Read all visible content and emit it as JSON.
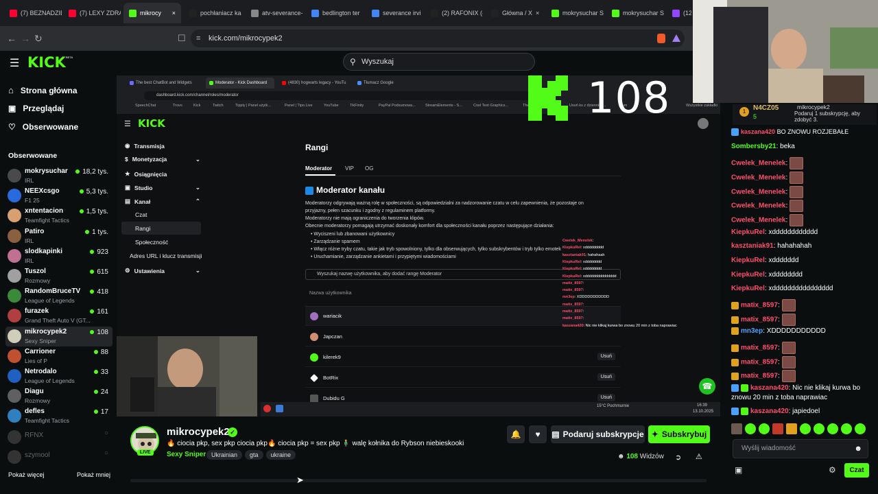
{
  "browser": {
    "tabs": [
      {
        "label": "(7) BEZNADZIE"
      },
      {
        "label": "(7) LEXY ZDRA"
      },
      {
        "label": "mikrocy"
      },
      {
        "label": "pochłaniacz ka"
      },
      {
        "label": "atv-severance-"
      },
      {
        "label": "bedlington ter"
      },
      {
        "label": "severance irvi"
      },
      {
        "label": "(2) RAFONIX (@"
      },
      {
        "label": "Główna / X"
      },
      {
        "label": "mokrysuchar S"
      },
      {
        "label": "mokrysuchar S"
      },
      {
        "label": "(12) p"
      }
    ],
    "url": "kick.com/mikrocypek2"
  },
  "kick": {
    "logo": "KICK",
    "logo_beta": "BETA",
    "search_placeholder": "Wyszukaj"
  },
  "sidebar": {
    "nav": [
      {
        "label": "Strona główna"
      },
      {
        "label": "Przeglądaj"
      },
      {
        "label": "Obserwowane"
      }
    ],
    "section_title": "Obserwowane",
    "channels": [
      {
        "name": "mokrysuchar",
        "category": "IRL",
        "viewers": "18,2 tys."
      },
      {
        "name": "NEEXcsgo",
        "category": "F1 25",
        "viewers": "5,3 tys."
      },
      {
        "name": "xntentacion",
        "category": "Teamfight Tactics",
        "viewers": "1,5 tys."
      },
      {
        "name": "Patiro",
        "category": "IRL",
        "viewers": "1 tys."
      },
      {
        "name": "slodkapinki",
        "category": "IRL",
        "viewers": "923"
      },
      {
        "name": "Tuszol",
        "category": "Rozmowy",
        "viewers": "615"
      },
      {
        "name": "RandomBruceTV",
        "category": "League of Legends",
        "viewers": "418"
      },
      {
        "name": "furazek",
        "category": "Grand Theft Auto V (GT...",
        "viewers": "161"
      },
      {
        "name": "mikrocypek2",
        "category": "Sexy Sniper",
        "viewers": "108"
      },
      {
        "name": "Carrioner",
        "category": "Lies of P",
        "viewers": "88"
      },
      {
        "name": "Netrodalo",
        "category": "League of Legends",
        "viewers": "33"
      },
      {
        "name": "Diagu",
        "category": "Rozmowy",
        "viewers": "24"
      },
      {
        "name": "defles",
        "category": "Teamfight Tactics",
        "viewers": "17"
      }
    ],
    "offline": [
      {
        "name": "RFNX"
      },
      {
        "name": "szymool"
      }
    ],
    "show_more": "Pokaż więcej",
    "show_less": "Pokaż mniej"
  },
  "inner": {
    "tabs": [
      "The best ChatBot and Widgets",
      "Moderator - Kick Dashboard",
      "(4830) hogwarts legacy - YouTu",
      "Tłumacz Google"
    ],
    "url": "dashboard.kick.com/channel/roles/moderator",
    "bookmarks": [
      "SpeechChat",
      "Trovo",
      "Kick",
      "Twitch",
      "Tipply | Panel użytk...",
      "Panel | Tipo.Live",
      "YouTube",
      "TikFinity",
      "PayPal Podsumowa...",
      "StreamElements - S...",
      "Cool Text Graphics...",
      "The",
      "Usuń ks z dziennika...",
      "Tłum",
      "Wszystkie zakładki"
    ],
    "dash_nav": [
      "Transmisja",
      "Monetyzacja",
      "Osiągnięcia",
      "Studio",
      "Kanał"
    ],
    "dash_sub": [
      "Czat",
      "Rangi",
      "Społeczność"
    ],
    "dash_url_item": "Adres URL i klucz transmisji",
    "dash_settings": "Ustawienia",
    "page_title": "Rangi",
    "role_tabs": [
      "Moderator",
      "VIP",
      "OG"
    ],
    "section_title": "Moderator kanału",
    "desc1": "Moderatorzy odgrywają ważną rolę w społeczności, są odpowiedzialni za nadzorowanie czatu w celu zapewnienia, że pozostaje on",
    "desc2": "przyjazny, pełen szacunku i zgodny z regulaminem platformy.",
    "desc3": "Moderatorzy nie mają ograniczenia do tworzenia klipów.",
    "desc4": "Obecnie moderatorzy pomagają utrzymać doskonały komfort dla społeczności kanału poprzez następujące działania:",
    "bullets": [
      "Wyciszeni lub zbanowani użytkownicy",
      "Zarządzanie spamem",
      "Włącz różne tryby czatu, takie jak tryb spowolniony, tylko dla obserwujących, tylko subskrybentów i tryb tylko emotek",
      "Uruchamianie, zarządzanie ankietami i przypiętymi wiadomościami"
    ],
    "search_placeholder": "Wyszukaj nazwę użytkownika, aby dodać rangę Moderator",
    "col_header": "Nazwa użytkownika",
    "users": [
      "wariacik",
      "Japczan",
      "kilerek9",
      "BotRix",
      "Dubidu G"
    ],
    "remove_label": "Usuń",
    "weather": "15°C Pochmurnie",
    "time": "16:39",
    "date": "13.10.2025"
  },
  "overlay_chat": [
    {
      "user": "Cwelek_Menelek",
      "text": ":"
    },
    {
      "user": "KiepkuRel",
      "text": ": xddddddddd"
    },
    {
      "user": "kasztaniak91",
      "text": ": hahahaah"
    },
    {
      "user": "KiepkuRel",
      "text": ": xdddddddd"
    },
    {
      "user": "KiepkuRel",
      "text": ": xdddddddd"
    },
    {
      "user": "KiepkuRel",
      "text": ": xddddddddddddddd"
    },
    {
      "user": "matix_8597",
      "text": ":"
    },
    {
      "user": "matix_8597",
      "text": ":"
    },
    {
      "user": "mn3ep",
      "text": ": XDDDDDDDDDDD"
    },
    {
      "user": "matix_8597",
      "text": ":"
    },
    {
      "user": "matix_8597",
      "text": ":"
    },
    {
      "user": "matix_8597",
      "text": ":"
    },
    {
      "user": "kaszana420",
      "text": ": Nic nie klikaj kurwa bo znowu 20 min z toba naprawiac"
    }
  ],
  "viewer_overlay": {
    "count": "108"
  },
  "stream_info": {
    "channel": "mikrocypek2",
    "live_label": "LIVE",
    "title": "🔥 ciocia pkp, sex pkp ciocia pkp🔥 ciocia pkp = sex pkp 🧍‍♂️ walę kołnika do Rybson niebieskooki",
    "category": "Sexy Sniper",
    "tags": [
      "Ukrainian",
      "gta",
      "ukraine"
    ],
    "gift_label": "Podaruj subskrypcje",
    "subscribe_label": "Subskrybuj",
    "viewers": "108",
    "viewers_label": "Widzów"
  },
  "chat": {
    "goal_name": "N4CZ05",
    "goal_count": "5",
    "goal_user": "mikrocypek2",
    "goal_text": "Podaruj 1 subskrypcję, aby zdobyć 3.",
    "top_msg": {
      "user": "kaszana420",
      "text": "BO ZNOWU ROZJEBAŁE"
    },
    "messages": [
      {
        "user": "Sombersby21",
        "text": ": beka",
        "color": "#53fc18",
        "emote": false,
        "badge": false
      },
      {
        "user": "Cwelek_Menelek",
        "text": ":",
        "color": "#ff4d6d",
        "emote": true,
        "badge": false
      },
      {
        "user": "Cwelek_Menelek",
        "text": ":",
        "color": "#ff4d6d",
        "emote": true,
        "badge": false
      },
      {
        "user": "Cwelek_Menelek",
        "text": ":",
        "color": "#ff4d6d",
        "emote": true,
        "badge": false
      },
      {
        "user": "Cwelek_Menelek",
        "text": ":",
        "color": "#ff4d6d",
        "emote": true,
        "badge": false
      },
      {
        "user": "Cwelek_Menelek",
        "text": ":",
        "color": "#ff4d6d",
        "emote": true,
        "badge": false
      },
      {
        "user": "KiepkuRel",
        "text": ": xdddddddddddd",
        "color": "#ff4d6d",
        "emote": false,
        "badge": false
      },
      {
        "user": "kasztaniak91",
        "text": ": hahahahah",
        "color": "#ff4d6d",
        "emote": false,
        "badge": false
      },
      {
        "user": "KiepkuRel",
        "text": ": xddddddd",
        "color": "#ff4d6d",
        "emote": false,
        "badge": false
      },
      {
        "user": "KiepkuRel",
        "text": ": xdddddddd",
        "color": "#ff4d6d",
        "emote": false,
        "badge": false
      },
      {
        "user": "KiepkuRel",
        "text": ": xdddddddddddddddd",
        "color": "#ff4d6d",
        "emote": false,
        "badge": false
      },
      {
        "user": "matix_8597",
        "text": ":",
        "color": "#ff4d6d",
        "emote": true,
        "badge": true
      },
      {
        "user": "matix_8597",
        "text": ":",
        "color": "#ff4d6d",
        "emote": true,
        "badge": true
      },
      {
        "user": "mn3ep",
        "text": ": XDDDDDDDDDDD",
        "color": "#53a0ff",
        "emote": false,
        "badge": true
      },
      {
        "user": "matix_8597",
        "text": ":",
        "color": "#ff4d6d",
        "emote": true,
        "badge": true
      },
      {
        "user": "matix_8597",
        "text": ":",
        "color": "#ff4d6d",
        "emote": true,
        "badge": true
      },
      {
        "user": "matix_8597",
        "text": ":",
        "color": "#ff4d6d",
        "emote": true,
        "badge": true
      }
    ],
    "long_msg": {
      "user": "kaszana420",
      "text": ": Nic nie klikaj kurwa bo",
      "text2": "znowu 20 min z toba naprawiac"
    },
    "last_msg": {
      "user": "kaszana420",
      "text": ": japiedoel"
    },
    "input_placeholder": "Wyślij wiadomość",
    "send_label": "Czat"
  },
  "colors": {
    "accent": "#53fc18",
    "username_red": "#ff4d6d",
    "bg": "#0b0e0f"
  }
}
